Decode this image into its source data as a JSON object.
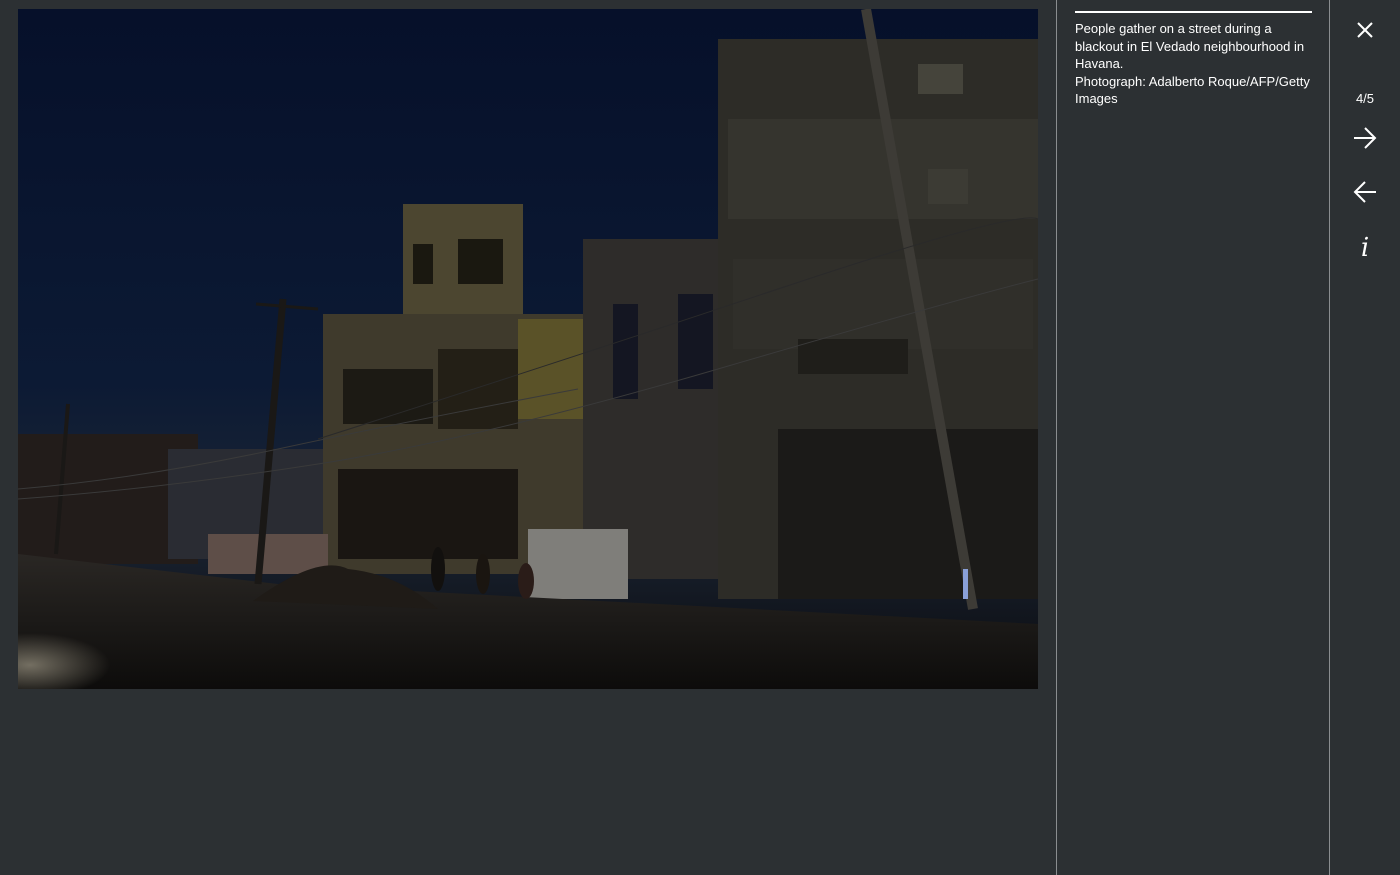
{
  "photo": {
    "caption": "People gather on a street during a blackout in El Vedado neighbourhood in Havana.",
    "credit": "Photograph: Adalberto Roque/AFP/Getty Images"
  },
  "nav": {
    "counter": "4/5",
    "close_icon": "close-icon",
    "next_icon": "arrow-right-icon",
    "prev_icon": "arrow-left-icon",
    "info_icon": "info-icon",
    "info_glyph": "i"
  },
  "colors": {
    "background": "#2c3033",
    "divider": "#8a8d90",
    "text": "#ffffff"
  }
}
